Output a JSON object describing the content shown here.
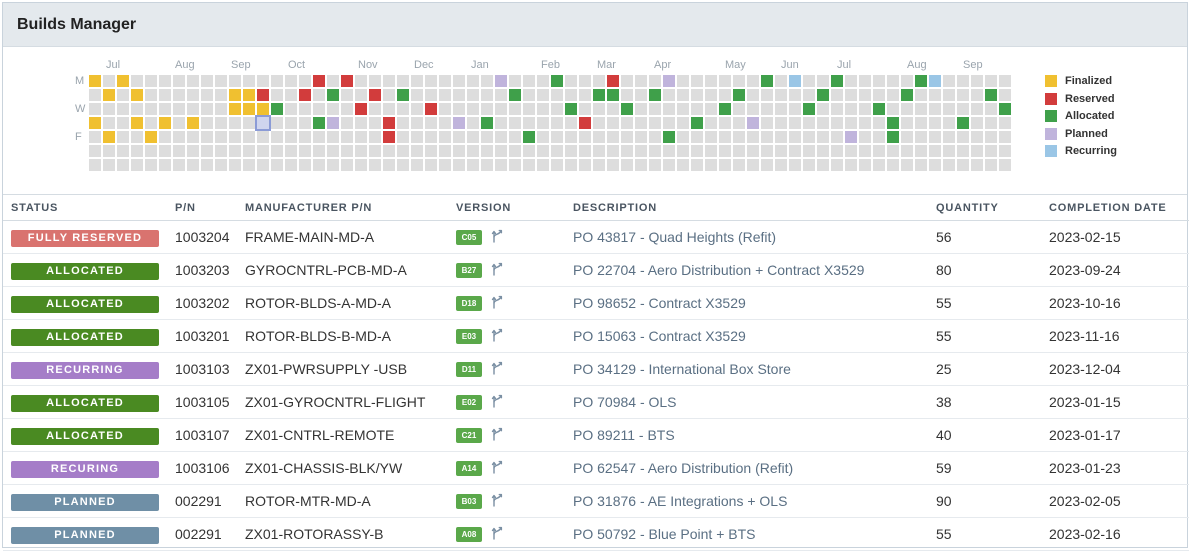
{
  "app": {
    "title": "Builds Manager"
  },
  "heatmap": {
    "months": [
      "Jul",
      "Aug",
      "Sep",
      "Oct",
      "Nov",
      "Dec",
      "Jan",
      "Feb",
      "Mar",
      "Apr",
      "May",
      "Jun",
      "Jul",
      "Aug",
      "Sep"
    ],
    "day_labels": [
      "M",
      "W",
      "F"
    ],
    "colors": {
      "empty": "#dddddd",
      "Finalized": "#f0c030",
      "Reserved": "#d23c3c",
      "Allocated": "#3fa04a",
      "Planned": "#c0b4dc",
      "Recurring": "#9ac6e6"
    },
    "filled": [
      [
        0,
        0,
        "Finalized"
      ],
      [
        1,
        1,
        "Finalized"
      ],
      [
        3,
        1,
        "Finalized"
      ],
      [
        2,
        0,
        "Finalized"
      ],
      [
        0,
        3,
        "Finalized"
      ],
      [
        1,
        4,
        "Finalized"
      ],
      [
        3,
        3,
        "Finalized"
      ],
      [
        4,
        4,
        "Finalized"
      ],
      [
        5,
        3,
        "Finalized"
      ],
      [
        7,
        3,
        "Finalized"
      ],
      [
        10,
        1,
        "Finalized"
      ],
      [
        11,
        1,
        "Finalized"
      ],
      [
        10,
        2,
        "Finalized"
      ],
      [
        11,
        2,
        "Finalized"
      ],
      [
        12,
        1,
        "Reserved"
      ],
      [
        12,
        2,
        "Finalized"
      ],
      [
        13,
        2,
        "Allocated"
      ],
      [
        15,
        1,
        "Reserved"
      ],
      [
        16,
        0,
        "Reserved"
      ],
      [
        17,
        1,
        "Allocated"
      ],
      [
        18,
        0,
        "Reserved"
      ],
      [
        16,
        3,
        "Allocated"
      ],
      [
        17,
        3,
        "Planned"
      ],
      [
        19,
        2,
        "Reserved"
      ],
      [
        20,
        1,
        "Reserved"
      ],
      [
        21,
        3,
        "Reserved"
      ],
      [
        21,
        4,
        "Reserved"
      ],
      [
        22,
        1,
        "Allocated"
      ],
      [
        24,
        2,
        "Reserved"
      ],
      [
        26,
        3,
        "Planned"
      ],
      [
        28,
        3,
        "Allocated"
      ],
      [
        29,
        0,
        "Planned"
      ],
      [
        30,
        1,
        "Allocated"
      ],
      [
        31,
        4,
        "Allocated"
      ],
      [
        33,
        0,
        "Allocated"
      ],
      [
        34,
        2,
        "Allocated"
      ],
      [
        35,
        3,
        "Reserved"
      ],
      [
        36,
        1,
        "Allocated"
      ],
      [
        37,
        1,
        "Allocated"
      ],
      [
        37,
        0,
        "Reserved"
      ],
      [
        38,
        2,
        "Allocated"
      ],
      [
        40,
        1,
        "Allocated"
      ],
      [
        41,
        0,
        "Planned"
      ],
      [
        41,
        4,
        "Allocated"
      ],
      [
        43,
        3,
        "Allocated"
      ],
      [
        45,
        2,
        "Allocated"
      ],
      [
        46,
        1,
        "Allocated"
      ],
      [
        47,
        3,
        "Planned"
      ],
      [
        48,
        0,
        "Allocated"
      ],
      [
        50,
        0,
        "Recurring"
      ],
      [
        51,
        2,
        "Allocated"
      ],
      [
        52,
        1,
        "Allocated"
      ],
      [
        53,
        0,
        "Allocated"
      ],
      [
        54,
        4,
        "Planned"
      ],
      [
        56,
        2,
        "Allocated"
      ],
      [
        57,
        3,
        "Allocated"
      ],
      [
        57,
        4,
        "Allocated"
      ],
      [
        58,
        1,
        "Allocated"
      ],
      [
        59,
        0,
        "Allocated"
      ],
      [
        60,
        0,
        "Recurring"
      ],
      [
        62,
        3,
        "Allocated"
      ],
      [
        64,
        1,
        "Allocated"
      ],
      [
        65,
        2,
        "Allocated"
      ],
      [
        67,
        1,
        "Planned"
      ],
      [
        68,
        0,
        "Recurring"
      ],
      [
        70,
        2,
        "Allocated"
      ],
      [
        70,
        3,
        "Planned"
      ],
      [
        72,
        0,
        "Recurring"
      ],
      [
        73,
        4,
        "Allocated"
      ]
    ],
    "selected": [
      12,
      3
    ]
  },
  "legend": [
    {
      "label": "Finalized",
      "color": "#f0c030"
    },
    {
      "label": "Reserved",
      "color": "#d23c3c"
    },
    {
      "label": "Allocated",
      "color": "#3fa04a"
    },
    {
      "label": "Planned",
      "color": "#c0b4dc"
    },
    {
      "label": "Recurring",
      "color": "#9ac6e6"
    }
  ],
  "table": {
    "headers": [
      "STATUS",
      "P/N",
      "MANUFACTURER P/N",
      "VERSION",
      "DESCRIPTION",
      "QUANTITY",
      "COMPLETION DATE"
    ],
    "status_colors": {
      "FULLY RESERVED": "#d9736f",
      "ALLOCATED": "#4a8a22",
      "RECURRING": "#a57dc8",
      "RECURING": "#a57dc8",
      "PLANNED": "#6f8fa6"
    },
    "rows": [
      {
        "status": "FULLY RESERVED",
        "pn": "1003204",
        "mpn": "FRAME-MAIN-MD-A",
        "version": "C05",
        "desc": "PO 43817 - Quad Heights (Refit)",
        "qty": "56",
        "date": "2023-02-15"
      },
      {
        "status": "ALLOCATED",
        "pn": "1003203",
        "mpn": "GYROCNTRL-PCB-MD-A",
        "version": "B27",
        "desc": "PO 22704 - Aero Distribution + Contract X3529",
        "qty": "80",
        "date": "2023-09-24"
      },
      {
        "status": "ALLOCATED",
        "pn": "1003202",
        "mpn": "ROTOR-BLDS-A-MD-A",
        "version": "D18",
        "desc": "PO 98652 - Contract X3529",
        "qty": "55",
        "date": "2023-10-16"
      },
      {
        "status": "ALLOCATED",
        "pn": "1003201",
        "mpn": "ROTOR-BLDS-B-MD-A",
        "version": "E03",
        "desc": "PO 15063 - Contract X3529",
        "qty": "55",
        "date": "2023-11-16"
      },
      {
        "status": "RECURRING",
        "pn": "1003103",
        "mpn": "ZX01-PWRSUPPLY -USB",
        "version": "D11",
        "desc": "PO 34129 - International Box Store",
        "qty": "25",
        "date": "2023-12-04"
      },
      {
        "status": "ALLOCATED",
        "pn": "1003105",
        "mpn": "ZX01-GYROCNTRL-FLIGHT",
        "version": "E02",
        "desc": "PO 70984 - OLS",
        "qty": "38",
        "date": "2023-01-15"
      },
      {
        "status": "ALLOCATED",
        "pn": "1003107",
        "mpn": "ZX01-CNTRL-REMOTE",
        "version": "C21",
        "desc": "PO 89211 - BTS",
        "qty": "40",
        "date": "2023-01-17"
      },
      {
        "status": "RECURING",
        "pn": "1003106",
        "mpn": "ZX01-CHASSIS-BLK/YW",
        "version": "A14",
        "desc": "PO 62547 - Aero Distribution (Refit)",
        "qty": "59",
        "date": "2023-01-23"
      },
      {
        "status": "PLANNED",
        "pn": "002291",
        "mpn": "ROTOR-MTR-MD-A",
        "version": "B03",
        "desc": "PO 31876 - AE Integrations + OLS",
        "qty": "90",
        "date": "2023-02-05"
      },
      {
        "status": "PLANNED",
        "pn": "002291",
        "mpn": "ZX01-ROTORASSY-B",
        "version": "A08",
        "desc": "PO 50792 - Blue Point + BTS",
        "qty": "55",
        "date": "2023-02-16"
      }
    ]
  }
}
